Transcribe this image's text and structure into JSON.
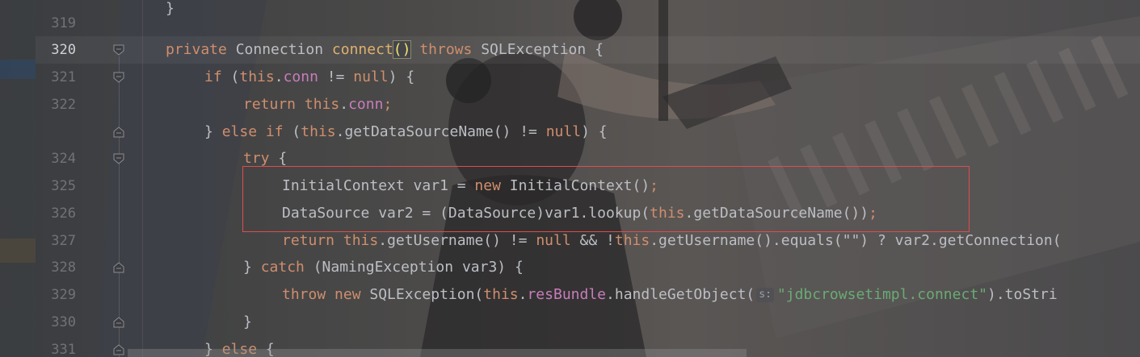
{
  "gutter": {
    "line_numbers": [
      "319",
      "320",
      "321",
      "322",
      "",
      "324",
      "325",
      "326",
      "327",
      "328",
      "329",
      "330",
      "331"
    ],
    "current_line": "320"
  },
  "code": {
    "l319": "}",
    "l320": {
      "kw1": "private",
      "type": "Connection",
      "fn": "connect",
      "paren": "()",
      "kw2": "throws",
      "exc": "SQLException",
      "brace": "{"
    },
    "l321": {
      "kw1": "if",
      "open": " (",
      "this": "this",
      "dot": ".",
      "field": "conn",
      "op": " != ",
      "null": "null",
      "close": ") {"
    },
    "l322": {
      "kw1": "return",
      "this": "this",
      "dot": ".",
      "field": "conn",
      "semi": ";"
    },
    "l323": {
      "brace": "} ",
      "kw1": "else",
      "kw2": "if",
      "open": " (",
      "this": "this",
      "rest": ".getDataSourceName() != ",
      "null": "null",
      "close": ") {"
    },
    "l324": {
      "kw1": "try",
      "brace": " {"
    },
    "l325": {
      "decl": "InitialContext var1 = ",
      "kw1": "new",
      "rest": " InitialContext()",
      "semi": ";"
    },
    "l326": {
      "decl": "DataSource var2 = (DataSource)var1.lookup(",
      "this": "this",
      "rest": ".getDataSourceName())",
      "semi": ";"
    },
    "l327": {
      "kw1": "return",
      "this1": "this",
      "mid1": ".getUsername() != ",
      "null": "null",
      "mid2": " && !",
      "this2": "this",
      "rest": ".getUsername().equals(\"\") ? var2.getConnection("
    },
    "l328": {
      "brace": "} ",
      "kw1": "catch",
      "rest": " (NamingException var3) {"
    },
    "l329": {
      "kw1": "throw",
      "kw2": "new",
      "cls": " SQLException(",
      "this": "this",
      "dot": ".",
      "field": "resBundle",
      "mid": ".handleGetObject(",
      "hint": "s:",
      "str": "\"jdbcrowsetimpl.connect\"",
      "rest": ").toStri"
    },
    "l330": {
      "brace": "}"
    },
    "l331": {
      "brace": "} ",
      "kw1": "else",
      "rest": " {"
    }
  },
  "colors": {
    "keyword": "#cf8e6d",
    "function": "#e0b06f",
    "field": "#c77dbb",
    "string": "#6aab73",
    "text": "#bcbec4",
    "highlight_box": "#e04c4c"
  }
}
